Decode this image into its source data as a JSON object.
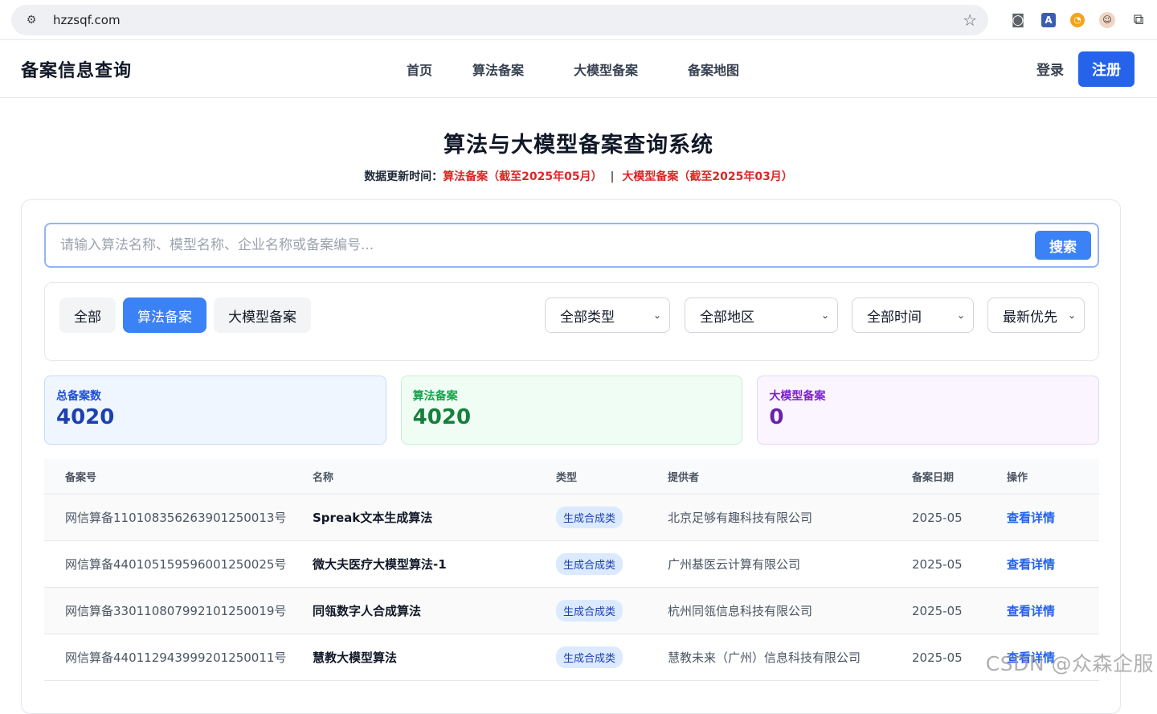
{
  "browser": {
    "url": "hzzsqf.com"
  },
  "header": {
    "brand": "备案信息查询",
    "nav": [
      "首页",
      "算法备案",
      "大模型备案",
      "备案地图"
    ],
    "login": "登录",
    "register": "注册"
  },
  "hero": {
    "title": "算法与大模型备案查询系统",
    "update_prefix": "数据更新时间：",
    "algo_update": "算法备案（截至2025年05月）",
    "sep": "|",
    "model_update": "大模型备案（截至2025年03月）"
  },
  "search": {
    "placeholder": "请输入算法名称、模型名称、企业名称或备案编号...",
    "value": "",
    "button": "搜索"
  },
  "filters": {
    "tabs": [
      "全部",
      "算法备案",
      "大模型备案"
    ],
    "active_tab": "算法备案",
    "type": "全部类型",
    "region": "全部地区",
    "time": "全部时间",
    "sort": "最新优先"
  },
  "stats": {
    "total_label": "总备案数",
    "total_value": "4020",
    "algo_label": "算法备案",
    "algo_value": "4020",
    "model_label": "大模型备案",
    "model_value": "0"
  },
  "table": {
    "headers": [
      "备案号",
      "名称",
      "类型",
      "提供者",
      "备案日期",
      "操作"
    ],
    "rows": [
      {
        "id": "网信算备110108356263901250013号",
        "name": "Spreak文本生成算法",
        "type": "生成合成类",
        "provider": "北京足够有趣科技有限公司",
        "date": "2025-05",
        "action": "查看详情"
      },
      {
        "id": "网信算备440105159596001250025号",
        "name": "微大夫医疗大模型算法-1",
        "type": "生成合成类",
        "provider": "广州基医云计算有限公司",
        "date": "2025-05",
        "action": "查看详情"
      },
      {
        "id": "网信算备330110807992101250019号",
        "name": "同瓴数字人合成算法",
        "type": "生成合成类",
        "provider": "杭州同瓴信息科技有限公司",
        "date": "2025-05",
        "action": "查看详情"
      },
      {
        "id": "网信算备440112943999201250011号",
        "name": "慧教大模型算法",
        "type": "生成合成类",
        "provider": "慧教未来（广州）信息科技有限公司",
        "date": "2025-05",
        "action": "查看详情"
      }
    ]
  },
  "watermark": "CSDN @众森企服",
  "colors": {
    "primary": "#2563eb",
    "accent_red": "#dc2626",
    "algo_green": "#16a34a",
    "model_purple": "#7e22ce"
  }
}
